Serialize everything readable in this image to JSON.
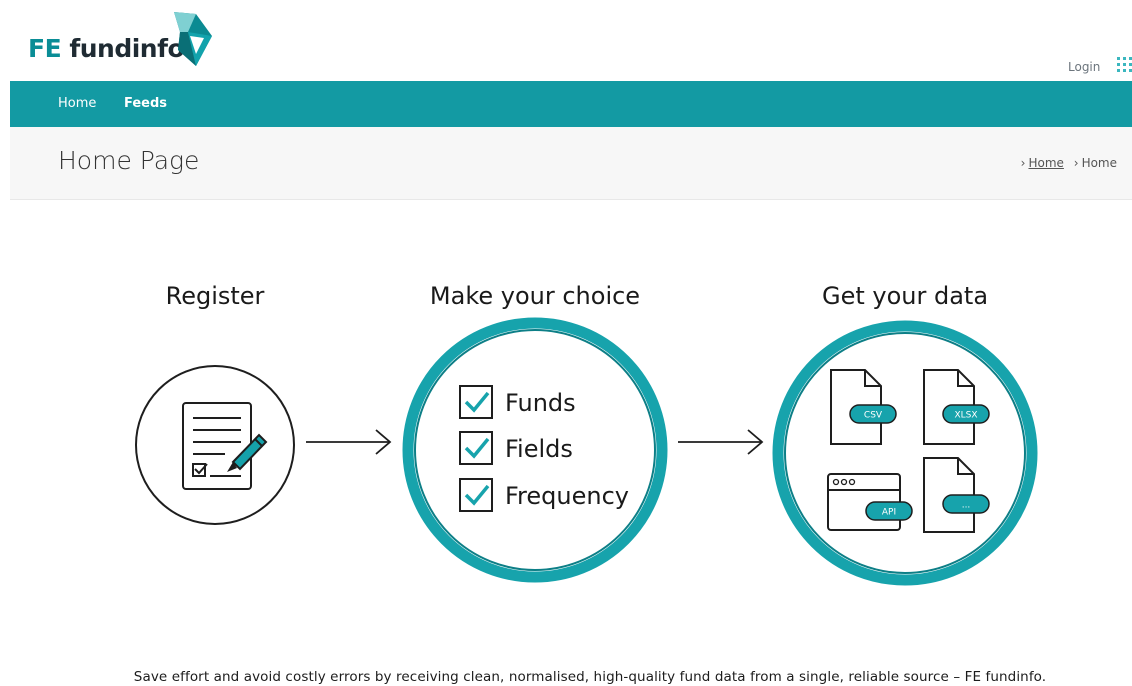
{
  "brand": {
    "fe": "FE",
    "name": "fundinfo",
    "teal": "#139aa3",
    "dark": "#1f2b33"
  },
  "header": {
    "login": "Login"
  },
  "nav": {
    "items": [
      {
        "label": "Home"
      },
      {
        "label": "Feeds"
      }
    ]
  },
  "titlebar": {
    "title": "Home Page",
    "breadcrumb": [
      {
        "label": "Home",
        "link": true
      },
      {
        "label": "Home",
        "link": false
      }
    ]
  },
  "infographic": {
    "steps": [
      {
        "title": "Register"
      },
      {
        "title": "Make your choice"
      },
      {
        "title": "Get your data"
      }
    ],
    "choices": [
      "Funds",
      "Fields",
      "Frequency"
    ],
    "formats": [
      "CSV",
      "XLSX",
      "API",
      "..."
    ]
  },
  "tagline": "Save effort and avoid costly errors by receiving clean, normalised, high-quality fund data from a single, reliable source – FE fundinfo."
}
